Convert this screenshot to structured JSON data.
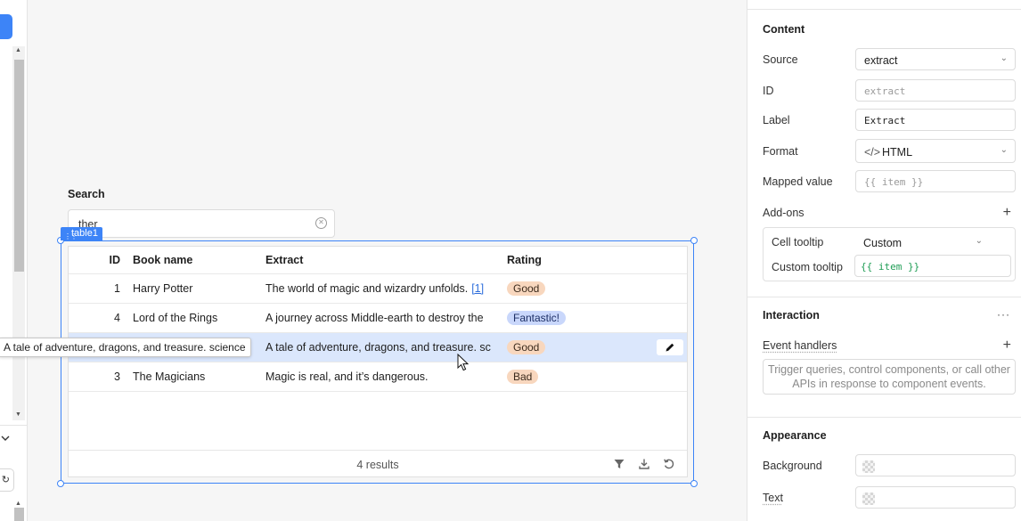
{
  "canvas": {
    "search_label": "Search",
    "search_value": "ther",
    "component_tag": "table1",
    "table": {
      "columns": [
        "ID",
        "Book name",
        "Extract",
        "Rating"
      ],
      "rows": [
        {
          "id": "1",
          "book": "Harry Potter",
          "extract": "The world of magic and wizardry unfolds.",
          "footnote": "[1]",
          "rating": "Good",
          "rating_kind": "good"
        },
        {
          "id": "4",
          "book": "Lord of the Rings",
          "extract": "A journey across Middle-earth to destroy the",
          "rating": "Fantastic!",
          "rating_kind": "fantastic"
        },
        {
          "id": "",
          "book": "",
          "extract": "A tale of adventure, dragons, and treasure. sc",
          "rating": "Good",
          "rating_kind": "good"
        },
        {
          "id": "3",
          "book": "The Magicians",
          "extract": "Magic is real, and it’s dangerous.",
          "rating": "Bad",
          "rating_kind": "bad"
        }
      ],
      "results_label": "4 results"
    },
    "tooltip": "A tale of adventure, dragons, and treasure. science"
  },
  "panel": {
    "content": {
      "title": "Content",
      "source_label": "Source",
      "source_value": "extract",
      "id_label": "ID",
      "id_placeholder": "extract",
      "label_label": "Label",
      "label_value": "Extract",
      "format_label": "Format",
      "format_value": "HTML",
      "mapped_label": "Mapped value",
      "mapped_placeholder": "{{ item }}",
      "addons_label": "Add-ons",
      "cell_tooltip_label": "Cell tooltip",
      "cell_tooltip_value": "Custom",
      "custom_tooltip_label": "Custom tooltip",
      "custom_tooltip_value": "{{ item }}"
    },
    "interaction": {
      "title": "Interaction",
      "event_handlers_label": "Event handlers",
      "empty_text": "Trigger queries, control components, or call other APIs in response to component events."
    },
    "appearance": {
      "title": "Appearance",
      "background_label": "Background",
      "text_label": "Text"
    }
  },
  "colors": {
    "accent": "#3d84f7",
    "selected_row": "#dbe7fc",
    "pill_good": "#f8d7be",
    "pill_fantastic": "#c9d7fb",
    "code_green": "#1f9d55"
  }
}
